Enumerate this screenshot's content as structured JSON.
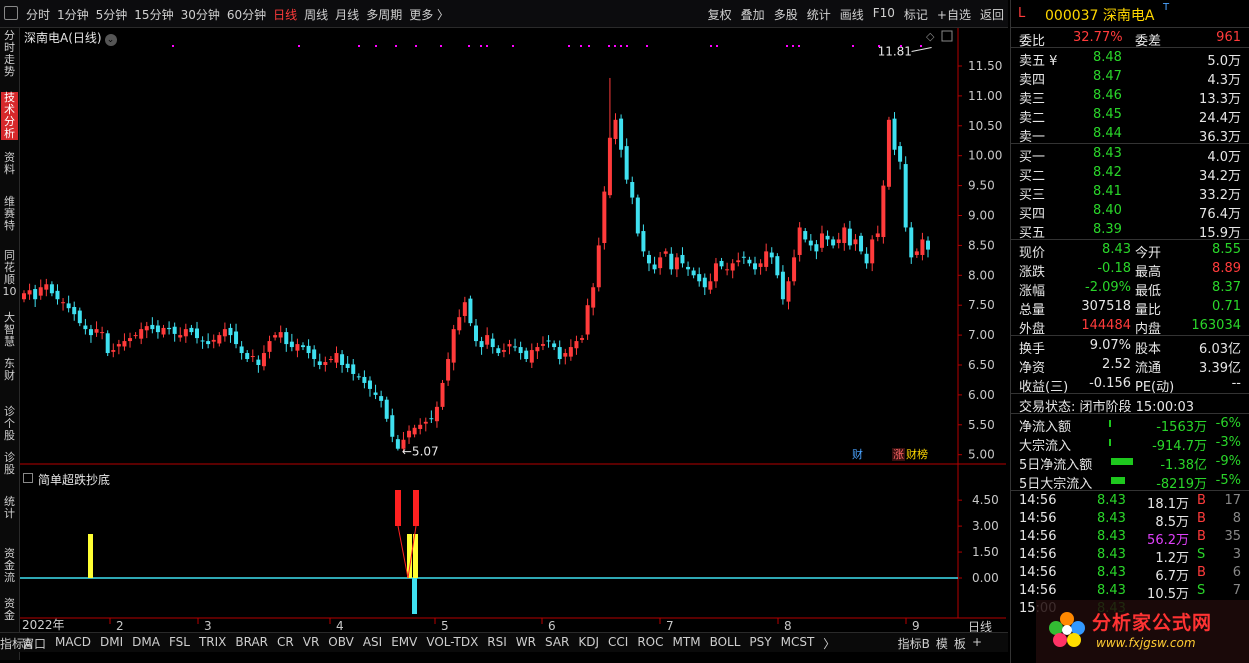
{
  "toolbar": {
    "periods": [
      "分时",
      "1分钟",
      "5分钟",
      "15分钟",
      "30分钟",
      "60分钟",
      "日线",
      "周线",
      "月线",
      "多周期",
      "更多 〉"
    ],
    "active_period": "日线",
    "tools": [
      "复权",
      "叠加",
      "多股",
      "统计",
      "画线",
      "F10",
      "标记",
      "+自选",
      "返回"
    ]
  },
  "left_tabs": [
    "分时走势",
    "技术分析",
    "资料",
    "维赛特",
    "同花顺10",
    "大智慧",
    "东财",
    "诊个股",
    "诊股",
    "统计",
    "资金流",
    "资金"
  ],
  "active_left_tab": "技术分析",
  "main_chart": {
    "title": "深南电A(日线)",
    "price_ticks": [
      "11.50",
      "11.00",
      "10.50",
      "10.00",
      "9.50",
      "9.00",
      "8.50",
      "8.00",
      "7.50",
      "7.00",
      "6.50",
      "6.00",
      "5.50",
      "5.00"
    ],
    "high_label": "11.81",
    "low_label": "5.07",
    "tag_cai": "财",
    "tag_zhang": "涨",
    "tag_caibang": "财榜"
  },
  "indicator_panel": {
    "title": "简单超跌抄底",
    "ticks": [
      "4.50",
      "3.00",
      "1.50",
      "0.00"
    ]
  },
  "x_axis": {
    "start_label": "2022年",
    "months": [
      "2",
      "3",
      "4",
      "5",
      "6",
      "7",
      "8",
      "9"
    ],
    "freq_label": "日线"
  },
  "bottom_tabs": {
    "prefix": "指标A",
    "items": [
      "窗口",
      "MACD",
      "DMI",
      "DMA",
      "FSL",
      "TRIX",
      "BRAR",
      "CR",
      "VR",
      "OBV",
      "ASI",
      "EMV",
      "VOL-TDX",
      "RSI",
      "WR",
      "SAR",
      "KDJ",
      "CCI",
      "ROC",
      "MTM",
      "BOLL",
      "PSY",
      "MCST",
      "〉"
    ],
    "right_items": [
      "指标B",
      "模",
      "板",
      "+"
    ]
  },
  "quote": {
    "flag": "L",
    "code_name": "000037 深南电A",
    "tag": "T",
    "webi_label": "委比",
    "webi": "32.77%",
    "weicha_label": "委差",
    "weicha": "961",
    "asks": [
      {
        "label": "卖五 ¥",
        "price": "8.48",
        "vol": "5.0万"
      },
      {
        "label": "卖四",
        "price": "8.47",
        "vol": "4.3万"
      },
      {
        "label": "卖三",
        "price": "8.46",
        "vol": "13.3万"
      },
      {
        "label": "卖二",
        "price": "8.45",
        "vol": "24.4万"
      },
      {
        "label": "卖一",
        "price": "8.44",
        "vol": "36.3万"
      }
    ],
    "bids": [
      {
        "label": "买一",
        "price": "8.43",
        "vol": "4.0万"
      },
      {
        "label": "买二",
        "price": "8.42",
        "vol": "34.2万"
      },
      {
        "label": "买三",
        "price": "8.41",
        "vol": "33.2万"
      },
      {
        "label": "买四",
        "price": "8.40",
        "vol": "76.4万"
      },
      {
        "label": "买五",
        "price": "8.39",
        "vol": "15.9万"
      }
    ],
    "stats": [
      {
        "l1": "现价",
        "v1": "8.43",
        "c1": "green",
        "l2": "今开",
        "v2": "8.55",
        "c2": "green"
      },
      {
        "l1": "涨跌",
        "v1": "-0.18",
        "c1": "green",
        "l2": "最高",
        "v2": "8.89",
        "c2": "red"
      },
      {
        "l1": "涨幅",
        "v1": "-2.09%",
        "c1": "green",
        "l2": "最低",
        "v2": "8.37",
        "c2": "green"
      },
      {
        "l1": "总量",
        "v1": "307518",
        "c1": "white",
        "l2": "量比",
        "v2": "0.71",
        "c2": "green"
      },
      {
        "l1": "外盘",
        "v1": "144484",
        "c1": "red",
        "l2": "内盘",
        "v2": "163034",
        "c2": "green"
      }
    ],
    "stats2": [
      {
        "l1": "换手",
        "v1": "9.07%",
        "c1": "white",
        "l2": "股本",
        "v2": "6.03亿",
        "c2": "white"
      },
      {
        "l1": "净资",
        "v1": "2.52",
        "c1": "white",
        "l2": "流通",
        "v2": "3.39亿",
        "c2": "white"
      },
      {
        "l1": "收益(三)",
        "v1": "-0.156",
        "c1": "white",
        "l2": "PE(动)",
        "v2": "--",
        "c2": "white"
      }
    ],
    "trade_status": "交易状态: 闭市阶段 15:00:03",
    "flows": [
      {
        "label": "净流入额",
        "value": "-1563万",
        "pct": "-6%",
        "bar": 2
      },
      {
        "label": "大宗流入",
        "value": "-914.7万",
        "pct": "-3%",
        "bar": 2
      },
      {
        "label": "5日净流入额",
        "value": "-1.38亿",
        "pct": "-9%",
        "bar": 22
      },
      {
        "label": "5日大宗流入",
        "value": "-8219万",
        "pct": "-5%",
        "bar": 14
      }
    ],
    "ticks": [
      {
        "time": "14:56",
        "price": "8.43",
        "vol": "18.1万",
        "side": "B",
        "n": "17",
        "vc": "white"
      },
      {
        "time": "14:56",
        "price": "8.43",
        "vol": "8.5万",
        "side": "B",
        "n": "8",
        "vc": "white"
      },
      {
        "time": "14:56",
        "price": "8.43",
        "vol": "56.2万",
        "side": "B",
        "n": "35",
        "vc": "magenta"
      },
      {
        "time": "14:56",
        "price": "8.43",
        "vol": "1.2万",
        "side": "S",
        "n": "3",
        "vc": "white"
      },
      {
        "time": "14:56",
        "price": "8.43",
        "vol": "6.7万",
        "side": "B",
        "n": "6",
        "vc": "white"
      },
      {
        "time": "14:56",
        "price": "8.43",
        "vol": "10.5万",
        "side": "S",
        "n": "7",
        "vc": "white"
      },
      {
        "time": "15:00",
        "price": "8.43",
        "vol": "",
        "side": "",
        "n": "",
        "vc": "white"
      }
    ]
  },
  "watermark": {
    "main": "分析家公式网",
    "sub": "www.fxjgsw.com"
  },
  "colors": {
    "up": "#ff3b3b",
    "down": "#3fe0f0",
    "axis": "#b40000",
    "signal_dot": "#ff00ff"
  }
}
